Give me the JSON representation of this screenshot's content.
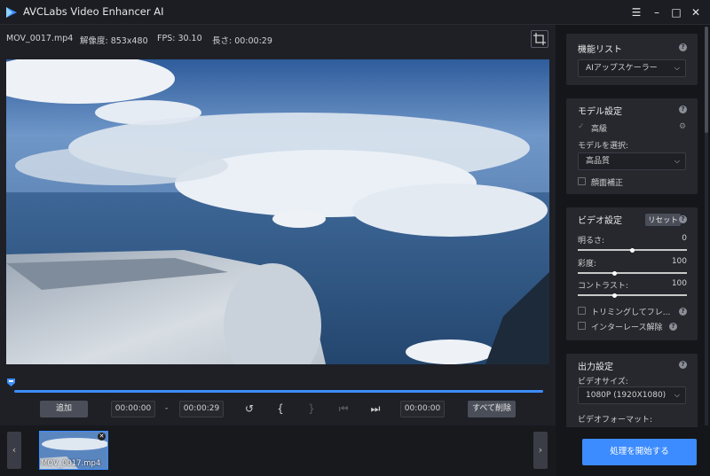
{
  "window": {
    "title": "AVCLabs Video Enhancer AI",
    "menu_icon": "hamburger-menu",
    "min_icon": "minimize",
    "max_icon": "maximize",
    "close_icon": "close"
  },
  "info": {
    "filename": "MOV_0017.mp4",
    "resolution": "解像度: 853x480",
    "fps": "FPS: 30.10",
    "duration": "長さ: 00:00:29"
  },
  "controls": {
    "add_label": "追加",
    "start_time": "00:00:00",
    "separator": "-",
    "end_time": "00:00:29",
    "current_time": "00:00:00",
    "clear_all_label": "すべて削除"
  },
  "filmstrip": {
    "thumb_label": "MOV_0017.mp4"
  },
  "function_panel": {
    "title": "機能リスト",
    "selected": "AIアップスケーラー"
  },
  "model_panel": {
    "title": "モデル設定",
    "advanced_label": "高級",
    "model_select_label": "モデルを選択:",
    "model_selected": "高品質",
    "face_label": "顔面補正"
  },
  "video_panel": {
    "title": "ビデオ設定",
    "reset_label": "リセット",
    "brightness_label": "明るさ:",
    "brightness_value": "0",
    "saturation_label": "彩度:",
    "saturation_value": "100",
    "contrast_label": "コントラスト:",
    "contrast_value": "100",
    "trim_label": "トリミングしてフレ...",
    "deinterlace_label": "インターレース解除"
  },
  "output_panel": {
    "title": "出力設定",
    "size_label": "ビデオサイズ:",
    "size_selected": "1080P (1920X1080)",
    "format_label": "ビデオフォーマット:"
  },
  "start_button": "処理を開始する",
  "colors": {
    "accent": "#3d8cff",
    "panel": "#26282e",
    "background": "#1e2026"
  }
}
